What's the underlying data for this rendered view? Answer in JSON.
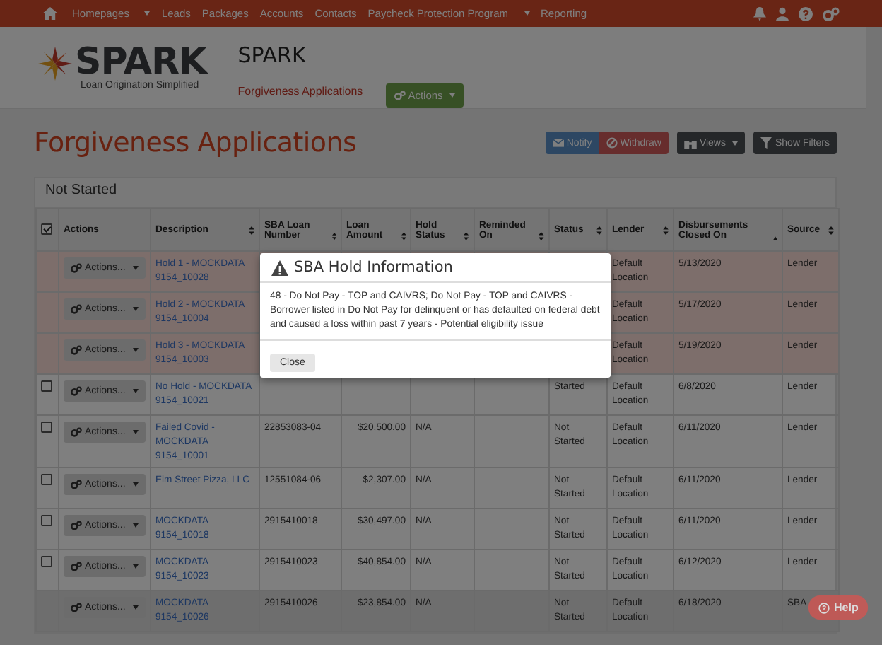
{
  "nav": {
    "items": [
      {
        "label": "Homepages",
        "dropdown": true
      },
      {
        "label": "Leads",
        "dropdown": false
      },
      {
        "label": "Packages",
        "dropdown": false
      },
      {
        "label": "Accounts",
        "dropdown": false
      },
      {
        "label": "Contacts",
        "dropdown": false
      },
      {
        "label": "Paycheck Protection Program",
        "dropdown": true
      },
      {
        "label": "Reporting",
        "dropdown": false
      }
    ]
  },
  "header": {
    "logo_name": "SPARK",
    "logo_tagline": "Loan Origination Simplified",
    "app_title": "SPARK",
    "subtitle": "Forgiveness Applications",
    "actions_button": "Actions"
  },
  "page": {
    "title": "Forgiveness Applications",
    "buttons": [
      {
        "label": "Notify",
        "kind": "notify"
      },
      {
        "label": "Withdraw",
        "kind": "withdraw"
      },
      {
        "label": "Views",
        "kind": "views"
      },
      {
        "label": "Show Filters",
        "kind": "filters"
      }
    ]
  },
  "table": {
    "title": "Not Started",
    "select_all": {
      "checked": true
    },
    "columns": [
      {
        "label": "Actions",
        "sortable": false
      },
      {
        "label": "Description",
        "sortable": true,
        "sorted": false
      },
      {
        "label": "SBA Loan Number",
        "sortable": true,
        "sorted": false
      },
      {
        "label": "Loan Amount",
        "sortable": true,
        "sorted": false
      },
      {
        "label": "Hold Status",
        "sortable": true,
        "sorted": false
      },
      {
        "label": "Reminded On",
        "sortable": true,
        "sorted": false
      },
      {
        "label": "Status",
        "sortable": true,
        "sorted": false
      },
      {
        "label": "Lender",
        "sortable": true,
        "sorted": false
      },
      {
        "label": "Disbursements Closed On",
        "sortable": true,
        "sorted": true
      },
      {
        "label": "Source",
        "sortable": true,
        "sorted": false
      }
    ],
    "rows": [
      {
        "checkbox": false,
        "hold": true,
        "hovered": false,
        "action": "Actions...",
        "description": "Hold 1 - MOCKDATA 9154_10028",
        "lender": "Default Location",
        "closed_on": "5/13/2020",
        "source": "Lender"
      },
      {
        "checkbox": false,
        "hold": true,
        "hovered": false,
        "action": "Actions...",
        "description": "Hold 2 - MOCKDATA 9154_10004",
        "lender": "Default Location",
        "closed_on": "5/17/2020",
        "source": "Lender"
      },
      {
        "checkbox": false,
        "hold": true,
        "hovered": false,
        "action": "Actions...",
        "description": "Hold 3 - MOCKDATA 9154_10003",
        "lender": "Default Location",
        "closed_on": "5/19/2020",
        "source": "Lender"
      },
      {
        "checkbox": true,
        "checked": false,
        "hold": false,
        "hovered": false,
        "action": "Actions...",
        "description": "No Hold - MOCKDATA 9154_10021",
        "status": "Started",
        "lender": "Default Location",
        "closed_on": "6/8/2020",
        "source": "Lender"
      },
      {
        "checkbox": true,
        "checked": false,
        "hold": false,
        "hovered": false,
        "action": "Actions...",
        "description": "Failed Covid - MOCKDATA 9154_10001",
        "loan_number": "22853083-04",
        "amount": "$20,500.00",
        "hold_status": "N/A",
        "status": "Not Started",
        "lender": "Default Location",
        "closed_on": "6/11/2020",
        "source": "Lender"
      },
      {
        "checkbox": true,
        "checked": false,
        "hold": false,
        "hovered": false,
        "action": "Actions...",
        "description": "Elm Street Pizza, LLC",
        "loan_number": "12551084-06",
        "amount": "$2,307.00",
        "hold_status": "N/A",
        "status": "Not Started",
        "lender": "Default Location",
        "closed_on": "6/11/2020",
        "source": "Lender"
      },
      {
        "checkbox": true,
        "checked": false,
        "hold": false,
        "hovered": false,
        "action": "Actions...",
        "description": "MOCKDATA 9154_10018",
        "loan_number": "2915410018",
        "amount": "$30,497.00",
        "hold_status": "N/A",
        "status": "Not Started",
        "lender": "Default Location",
        "closed_on": "6/11/2020",
        "source": "Lender"
      },
      {
        "checkbox": true,
        "checked": false,
        "hold": false,
        "hovered": false,
        "action": "Actions...",
        "description": "MOCKDATA 9154_10023",
        "loan_number": "2915410023",
        "amount": "$40,854.00",
        "hold_status": "N/A",
        "status": "Not Started",
        "lender": "Default Location",
        "closed_on": "6/12/2020",
        "source": "Lender"
      },
      {
        "checkbox": false,
        "hold": false,
        "hovered": true,
        "action": "Actions...",
        "description": "MOCKDATA 9154_10026",
        "loan_number": "2915410026",
        "amount": "$23,854.00",
        "hold_status": "N/A",
        "status": "Not Started",
        "lender": "Default Location",
        "closed_on": "6/18/2020",
        "source": "SBA"
      }
    ]
  },
  "modal": {
    "title": "SBA Hold Information",
    "body": "48 - Do Not Pay - TOP and CAIVRS; Do Not Pay - TOP and CAIVRS - Borrower listed in Do Not Pay for delinquent or has defaulted on federal debt and caused a loss within past 7 years - Potential eligibility issue",
    "close_button": "Close"
  },
  "help_button": "Help"
}
